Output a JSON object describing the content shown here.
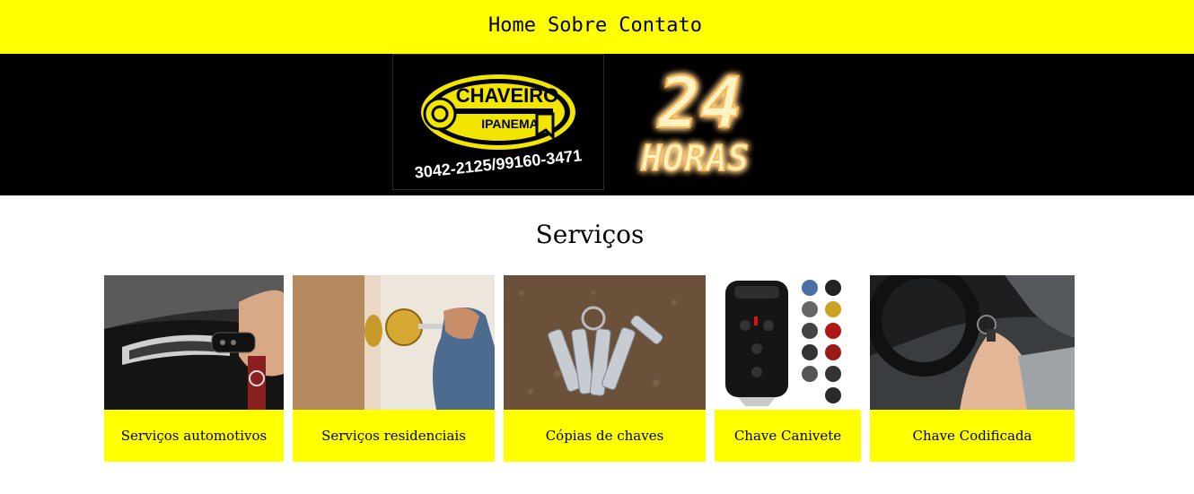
{
  "nav": {
    "items": [
      {
        "label": "Home"
      },
      {
        "label": "Sobre"
      },
      {
        "label": "Contato"
      }
    ]
  },
  "banner": {
    "logo_title": "CHAVEIRO",
    "logo_subtitle": "IPANEMA",
    "phones": "3042-2125/99160-3471",
    "hours_number": "24",
    "hours_word": "HORAS"
  },
  "services": {
    "title": "Serviços",
    "cards": [
      {
        "label": "Serviços automotivos"
      },
      {
        "label": "Serviços residenciais"
      },
      {
        "label": "Cópias de chaves"
      },
      {
        "label": "Chave Canivete"
      },
      {
        "label": "Chave Codificada"
      }
    ]
  },
  "colors": {
    "accent_yellow": "#ffff00",
    "banner_black": "#000000",
    "logo_yellow": "#f2e600",
    "glow_orange": "#ffb347"
  }
}
